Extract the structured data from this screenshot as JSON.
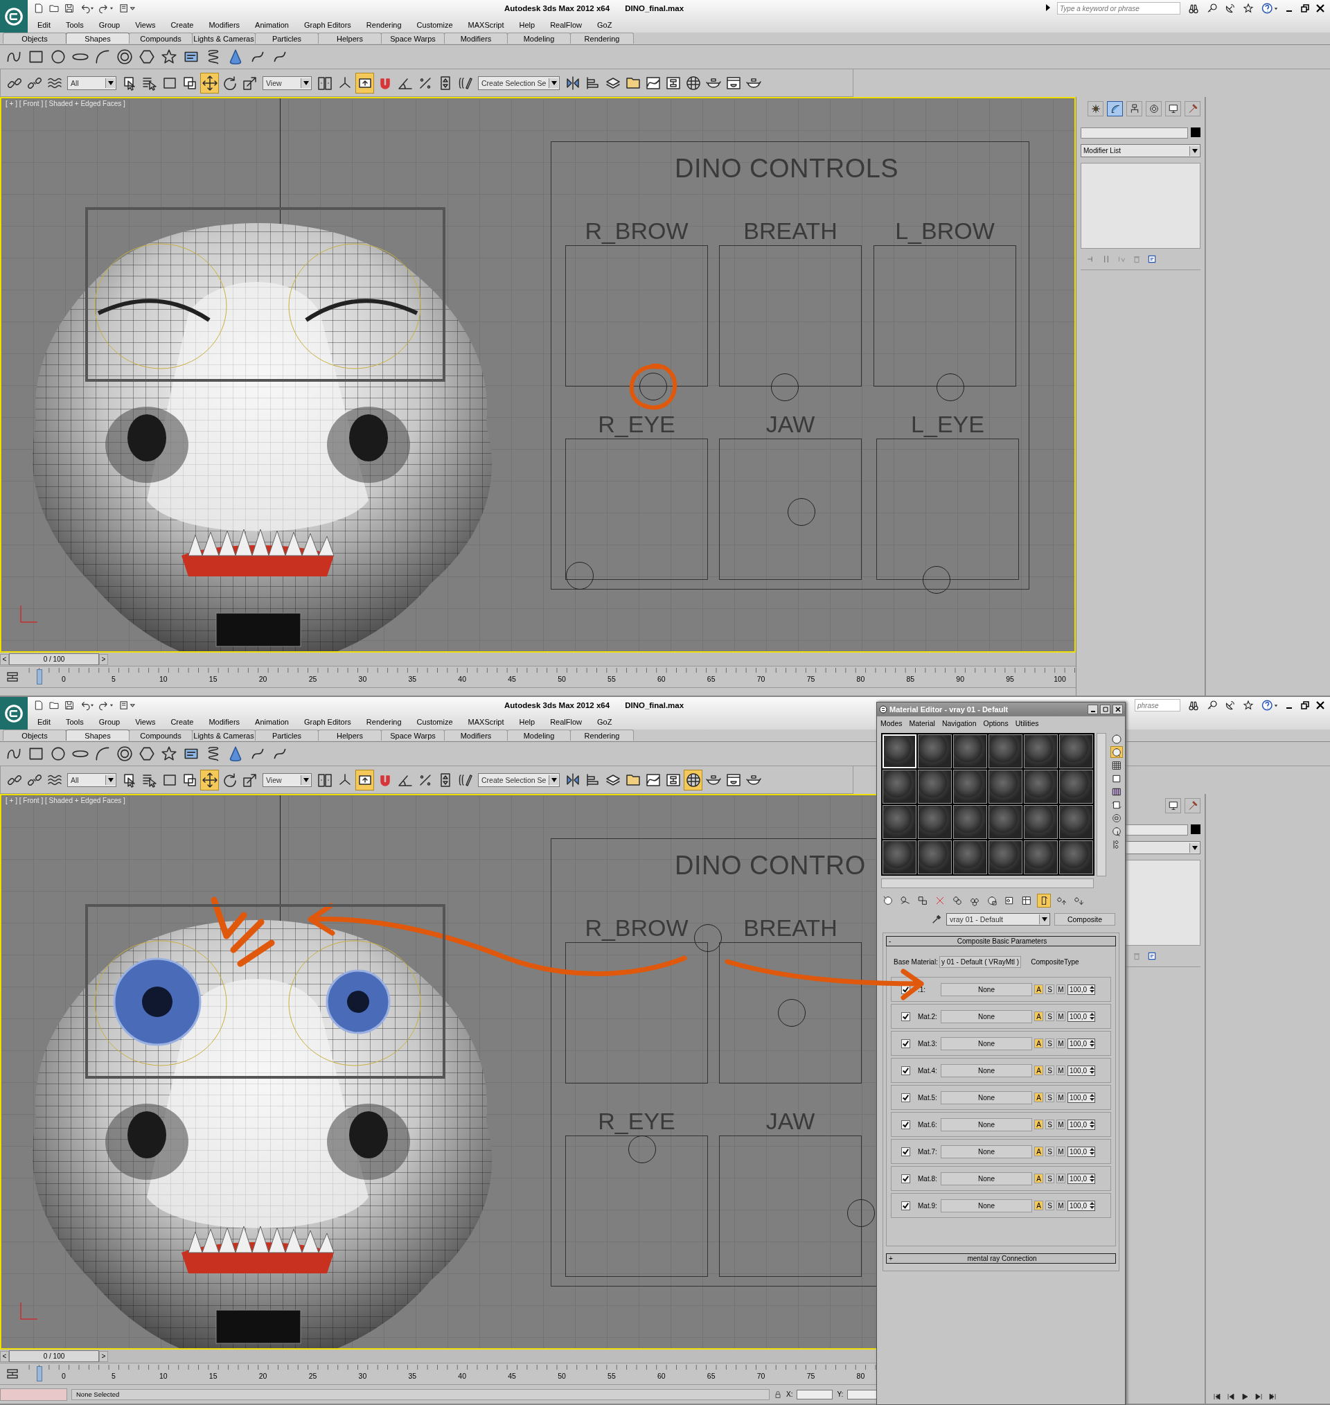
{
  "panes": [
    {
      "app_title": "Autodesk 3ds Max  2012 x64",
      "file_name": "DINO_final.max",
      "search": {
        "placeholder": "Type a keyword or phrase"
      },
      "menu": [
        "Edit",
        "Tools",
        "Group",
        "Views",
        "Create",
        "Modifiers",
        "Animation",
        "Graph Editors",
        "Rendering",
        "Customize",
        "MAXScript",
        "Help",
        "RealFlow",
        "GoZ"
      ],
      "ribbon_tabs": [
        {
          "label": "Objects",
          "selected": false
        },
        {
          "label": "Shapes",
          "selected": true
        },
        {
          "label": "Compounds",
          "selected": false
        },
        {
          "label": "Lights & Cameras",
          "selected": false
        },
        {
          "label": "Particles",
          "selected": false
        },
        {
          "label": "Helpers",
          "selected": false
        },
        {
          "label": "Space Warps",
          "selected": false
        },
        {
          "label": "Modifiers",
          "selected": false
        },
        {
          "label": "Modeling",
          "selected": false
        },
        {
          "label": "Rendering",
          "selected": false
        }
      ],
      "main_tools": [
        {
          "kind": "link",
          "active": false
        },
        {
          "kind": "unlink",
          "active": false
        },
        {
          "kind": "bind",
          "active": false
        },
        {
          "kind": "dropdown",
          "value": "All"
        },
        {
          "kind": "select",
          "active": false
        },
        {
          "kind": "select-by-name",
          "active": false
        },
        {
          "kind": "region",
          "active": false
        },
        {
          "kind": "crossing",
          "active": false
        },
        {
          "kind": "move",
          "active": true
        },
        {
          "kind": "rotate",
          "active": false
        },
        {
          "kind": "scale",
          "active": false
        },
        {
          "kind": "dropdown",
          "value": "View"
        },
        {
          "kind": "pivot",
          "active": false
        },
        {
          "kind": "manipulate",
          "active": false
        },
        {
          "kind": "override",
          "active": true
        },
        {
          "kind": "snap",
          "active": false
        },
        {
          "kind": "angle-snap",
          "active": false
        },
        {
          "kind": "percent-snap",
          "active": false
        },
        {
          "kind": "spinner-snap",
          "active": false
        },
        {
          "kind": "named-sets",
          "active": false
        },
        {
          "kind": "dropdown",
          "value": "Create Selection Se"
        },
        {
          "kind": "mirror",
          "active": false
        },
        {
          "kind": "align",
          "active": false
        },
        {
          "kind": "layers",
          "active": false
        },
        {
          "kind": "explorer",
          "active": false
        },
        {
          "kind": "curve-editor",
          "active": false
        },
        {
          "kind": "schematic",
          "active": false
        },
        {
          "kind": "material",
          "active": false
        },
        {
          "kind": "render-setup",
          "active": false
        },
        {
          "kind": "render-frame",
          "active": false
        },
        {
          "kind": "render",
          "active": false
        }
      ],
      "viewport": {
        "label": "[ + ] [ Front ] [ Shaded + Edged Faces ]",
        "eyes_open": false,
        "annotations": [
          {
            "kind": "circle"
          }
        ],
        "panel_title": "DINO CONTROLS",
        "controls": [
          {
            "label": "R_BROW"
          },
          {
            "label": "BREATH"
          },
          {
            "label": "L_BROW"
          },
          {
            "label": "R_EYE"
          },
          {
            "label": "JAW"
          },
          {
            "label": "L_EYE"
          }
        ]
      },
      "command_panel": {
        "tabs": [
          {
            "kind": "create",
            "selected": false
          },
          {
            "kind": "modify",
            "selected": true
          },
          {
            "kind": "hierarchy",
            "selected": false
          },
          {
            "kind": "motion",
            "selected": false
          },
          {
            "kind": "display",
            "selected": false
          },
          {
            "kind": "utilities",
            "selected": false
          }
        ],
        "modifier_list": "Modifier List"
      },
      "time_slider": {
        "prev": "<",
        "frame": "0 / 100",
        "next": ">"
      },
      "ticks": [
        "0",
        "5",
        "10",
        "15",
        "20",
        "25",
        "30",
        "35",
        "40",
        "45",
        "50",
        "55",
        "60",
        "65",
        "70",
        "75",
        "80",
        "85",
        "90",
        "95",
        "100"
      ]
    },
    {
      "app_title": "Autodesk 3ds Max  2012 x64",
      "file_name": "DINO_final.max",
      "search": {
        "placeholder": "phrase"
      },
      "menu": [
        "Edit",
        "Tools",
        "Group",
        "Views",
        "Create",
        "Modifiers",
        "Animation",
        "Graph Editors",
        "Rendering",
        "Customize",
        "MAXScript",
        "Help",
        "RealFlow",
        "GoZ"
      ],
      "ribbon_tabs": [
        {
          "label": "Objects",
          "selected": false
        },
        {
          "label": "Shapes",
          "selected": true
        },
        {
          "label": "Compounds",
          "selected": false
        },
        {
          "label": "Lights & Cameras",
          "selected": false
        },
        {
          "label": "Particles",
          "selected": false
        },
        {
          "label": "Helpers",
          "selected": false
        },
        {
          "label": "Space Warps",
          "selected": false
        },
        {
          "label": "Modifiers",
          "selected": false
        },
        {
          "label": "Modeling",
          "selected": false
        },
        {
          "label": "Rendering",
          "selected": false
        }
      ],
      "main_tools": [
        {
          "kind": "link",
          "active": false
        },
        {
          "kind": "unlink",
          "active": false
        },
        {
          "kind": "bind",
          "active": false
        },
        {
          "kind": "dropdown",
          "value": "All"
        },
        {
          "kind": "select",
          "active": false
        },
        {
          "kind": "select-by-name",
          "active": false
        },
        {
          "kind": "region",
          "active": false
        },
        {
          "kind": "crossing",
          "active": false
        },
        {
          "kind": "move",
          "active": true
        },
        {
          "kind": "rotate",
          "active": false
        },
        {
          "kind": "scale",
          "active": false
        },
        {
          "kind": "dropdown",
          "value": "View"
        },
        {
          "kind": "pivot",
          "active": false
        },
        {
          "kind": "manipulate",
          "active": false
        },
        {
          "kind": "override",
          "active": true
        },
        {
          "kind": "snap",
          "active": false
        },
        {
          "kind": "angle-snap",
          "active": false
        },
        {
          "kind": "percent-snap",
          "active": false
        },
        {
          "kind": "spinner-snap",
          "active": false
        },
        {
          "kind": "named-sets",
          "active": false
        },
        {
          "kind": "dropdown",
          "value": "Create Selection Se"
        },
        {
          "kind": "mirror",
          "active": false
        },
        {
          "kind": "align",
          "active": false
        },
        {
          "kind": "layers",
          "active": false
        },
        {
          "kind": "explorer",
          "active": false
        },
        {
          "kind": "curve-editor",
          "active": false
        },
        {
          "kind": "schematic",
          "active": false
        },
        {
          "kind": "material",
          "active": true
        },
        {
          "kind": "render-setup",
          "active": false
        },
        {
          "kind": "render-frame",
          "active": false
        },
        {
          "kind": "render",
          "active": false
        }
      ],
      "viewport": {
        "label": "[ + ] [ Front ] [ Shaded + Edged Faces ]",
        "eyes_open": true,
        "annotations": [
          {
            "kind": "strokes"
          },
          {
            "kind": "arrow"
          },
          {
            "kind": "editor-arrow"
          }
        ],
        "panel_title": "DINO CONTRO",
        "controls": [
          {
            "label": "R_BROW"
          },
          {
            "label": "BREATH"
          },
          {
            "label": "R_EYE"
          },
          {
            "label": "JAW"
          }
        ]
      },
      "command_panel": {
        "tabs": [
          {
            "kind": "display",
            "selected": false
          },
          {
            "kind": "utilities",
            "selected": false
          }
        ]
      },
      "time_slider": {
        "prev": "<",
        "frame": "0 / 100",
        "next": ">"
      },
      "ticks": [
        "0",
        "5",
        "10",
        "15",
        "20",
        "25",
        "30",
        "35",
        "40",
        "45",
        "50",
        "55",
        "60",
        "65",
        "70",
        "75",
        "80"
      ],
      "status": {
        "selection": "None Selected",
        "x_label": "X:",
        "y_label": "Y:"
      }
    }
  ],
  "material_editor": {
    "title": "Material Editor - vray 01 - Default",
    "menu": [
      "Modes",
      "Material",
      "Navigation",
      "Options",
      "Utilities"
    ],
    "slots": [
      {
        "selected": true
      },
      {
        "selected": false
      },
      {
        "selected": false
      },
      {
        "selected": false
      },
      {
        "selected": false
      },
      {
        "selected": false
      },
      {
        "selected": false
      },
      {
        "selected": false
      },
      {
        "selected": false
      },
      {
        "selected": false
      },
      {
        "selected": false
      },
      {
        "selected": false
      },
      {
        "selected": false
      },
      {
        "selected": false
      },
      {
        "selected": false
      },
      {
        "selected": false
      },
      {
        "selected": false
      },
      {
        "selected": false
      },
      {
        "selected": false
      },
      {
        "selected": false
      },
      {
        "selected": false
      },
      {
        "selected": false
      },
      {
        "selected": false
      },
      {
        "selected": false
      }
    ],
    "side_tools": [
      {
        "kind": "sphere",
        "active": false
      },
      {
        "kind": "backlight",
        "active": true
      },
      {
        "kind": "checker",
        "active": false
      },
      {
        "kind": "tiling",
        "active": false
      },
      {
        "kind": "video-check",
        "active": false
      },
      {
        "kind": "preview",
        "active": false
      },
      {
        "kind": "options",
        "active": false
      },
      {
        "kind": "select-by-material",
        "active": false
      },
      {
        "kind": "navigator",
        "active": false
      }
    ],
    "tools": [
      {
        "kind": "get-material",
        "active": false
      },
      {
        "kind": "put-scene",
        "active": false
      },
      {
        "kind": "assign",
        "active": false
      },
      {
        "kind": "reset",
        "active": false
      },
      {
        "kind": "copy",
        "active": false
      },
      {
        "kind": "unique",
        "active": false
      },
      {
        "kind": "library",
        "active": false
      },
      {
        "kind": "material-id",
        "active": false
      },
      {
        "kind": "show-map",
        "active": false
      },
      {
        "kind": "end-result",
        "active": true
      },
      {
        "kind": "parent",
        "active": false
      },
      {
        "kind": "forward",
        "active": false
      }
    ],
    "material_name": "vray 01 - Default",
    "material_type": "Composite",
    "rollouts": [
      {
        "toggle": "-",
        "title": "Composite Basic Parameters",
        "expanded": true
      },
      {
        "toggle": "+",
        "title": "mental ray Connection",
        "expanded": false
      }
    ],
    "base_material_label": "Base Material:",
    "base_material": "y 01 - Default  ( VRayMtl )",
    "composite_type": "CompositeType",
    "materials": [
      {
        "label": ".1:",
        "enabled": true,
        "map": "None",
        "modes": [
          {
            "label": "A",
            "selected": true
          },
          {
            "label": "S",
            "selected": false
          },
          {
            "label": "M",
            "selected": false
          }
        ],
        "amount": "100,0"
      },
      {
        "label": "Mat.2:",
        "enabled": true,
        "map": "None",
        "modes": [
          {
            "label": "A",
            "selected": true
          },
          {
            "label": "S",
            "selected": false
          },
          {
            "label": "M",
            "selected": false
          }
        ],
        "amount": "100,0"
      },
      {
        "label": "Mat.3:",
        "enabled": true,
        "map": "None",
        "modes": [
          {
            "label": "A",
            "selected": true
          },
          {
            "label": "S",
            "selected": false
          },
          {
            "label": "M",
            "selected": false
          }
        ],
        "amount": "100,0"
      },
      {
        "label": "Mat.4:",
        "enabled": true,
        "map": "None",
        "modes": [
          {
            "label": "A",
            "selected": true
          },
          {
            "label": "S",
            "selected": false
          },
          {
            "label": "M",
            "selected": false
          }
        ],
        "amount": "100,0"
      },
      {
        "label": "Mat.5:",
        "enabled": true,
        "map": "None",
        "modes": [
          {
            "label": "A",
            "selected": true
          },
          {
            "label": "S",
            "selected": false
          },
          {
            "label": "M",
            "selected": false
          }
        ],
        "amount": "100,0"
      },
      {
        "label": "Mat.6:",
        "enabled": true,
        "map": "None",
        "modes": [
          {
            "label": "A",
            "selected": true
          },
          {
            "label": "S",
            "selected": false
          },
          {
            "label": "M",
            "selected": false
          }
        ],
        "amount": "100,0"
      },
      {
        "label": "Mat.7:",
        "enabled": true,
        "map": "None",
        "modes": [
          {
            "label": "A",
            "selected": true
          },
          {
            "label": "S",
            "selected": false
          },
          {
            "label": "M",
            "selected": false
          }
        ],
        "amount": "100,0"
      },
      {
        "label": "Mat.8:",
        "enabled": true,
        "map": "None",
        "modes": [
          {
            "label": "A",
            "selected": true
          },
          {
            "label": "S",
            "selected": false
          },
          {
            "label": "M",
            "selected": false
          }
        ],
        "amount": "100,0"
      },
      {
        "label": "Mat.9:",
        "enabled": true,
        "map": "None",
        "modes": [
          {
            "label": "A",
            "selected": true
          },
          {
            "label": "S",
            "selected": false
          },
          {
            "label": "M",
            "selected": false
          }
        ],
        "amount": "100,0"
      }
    ]
  }
}
